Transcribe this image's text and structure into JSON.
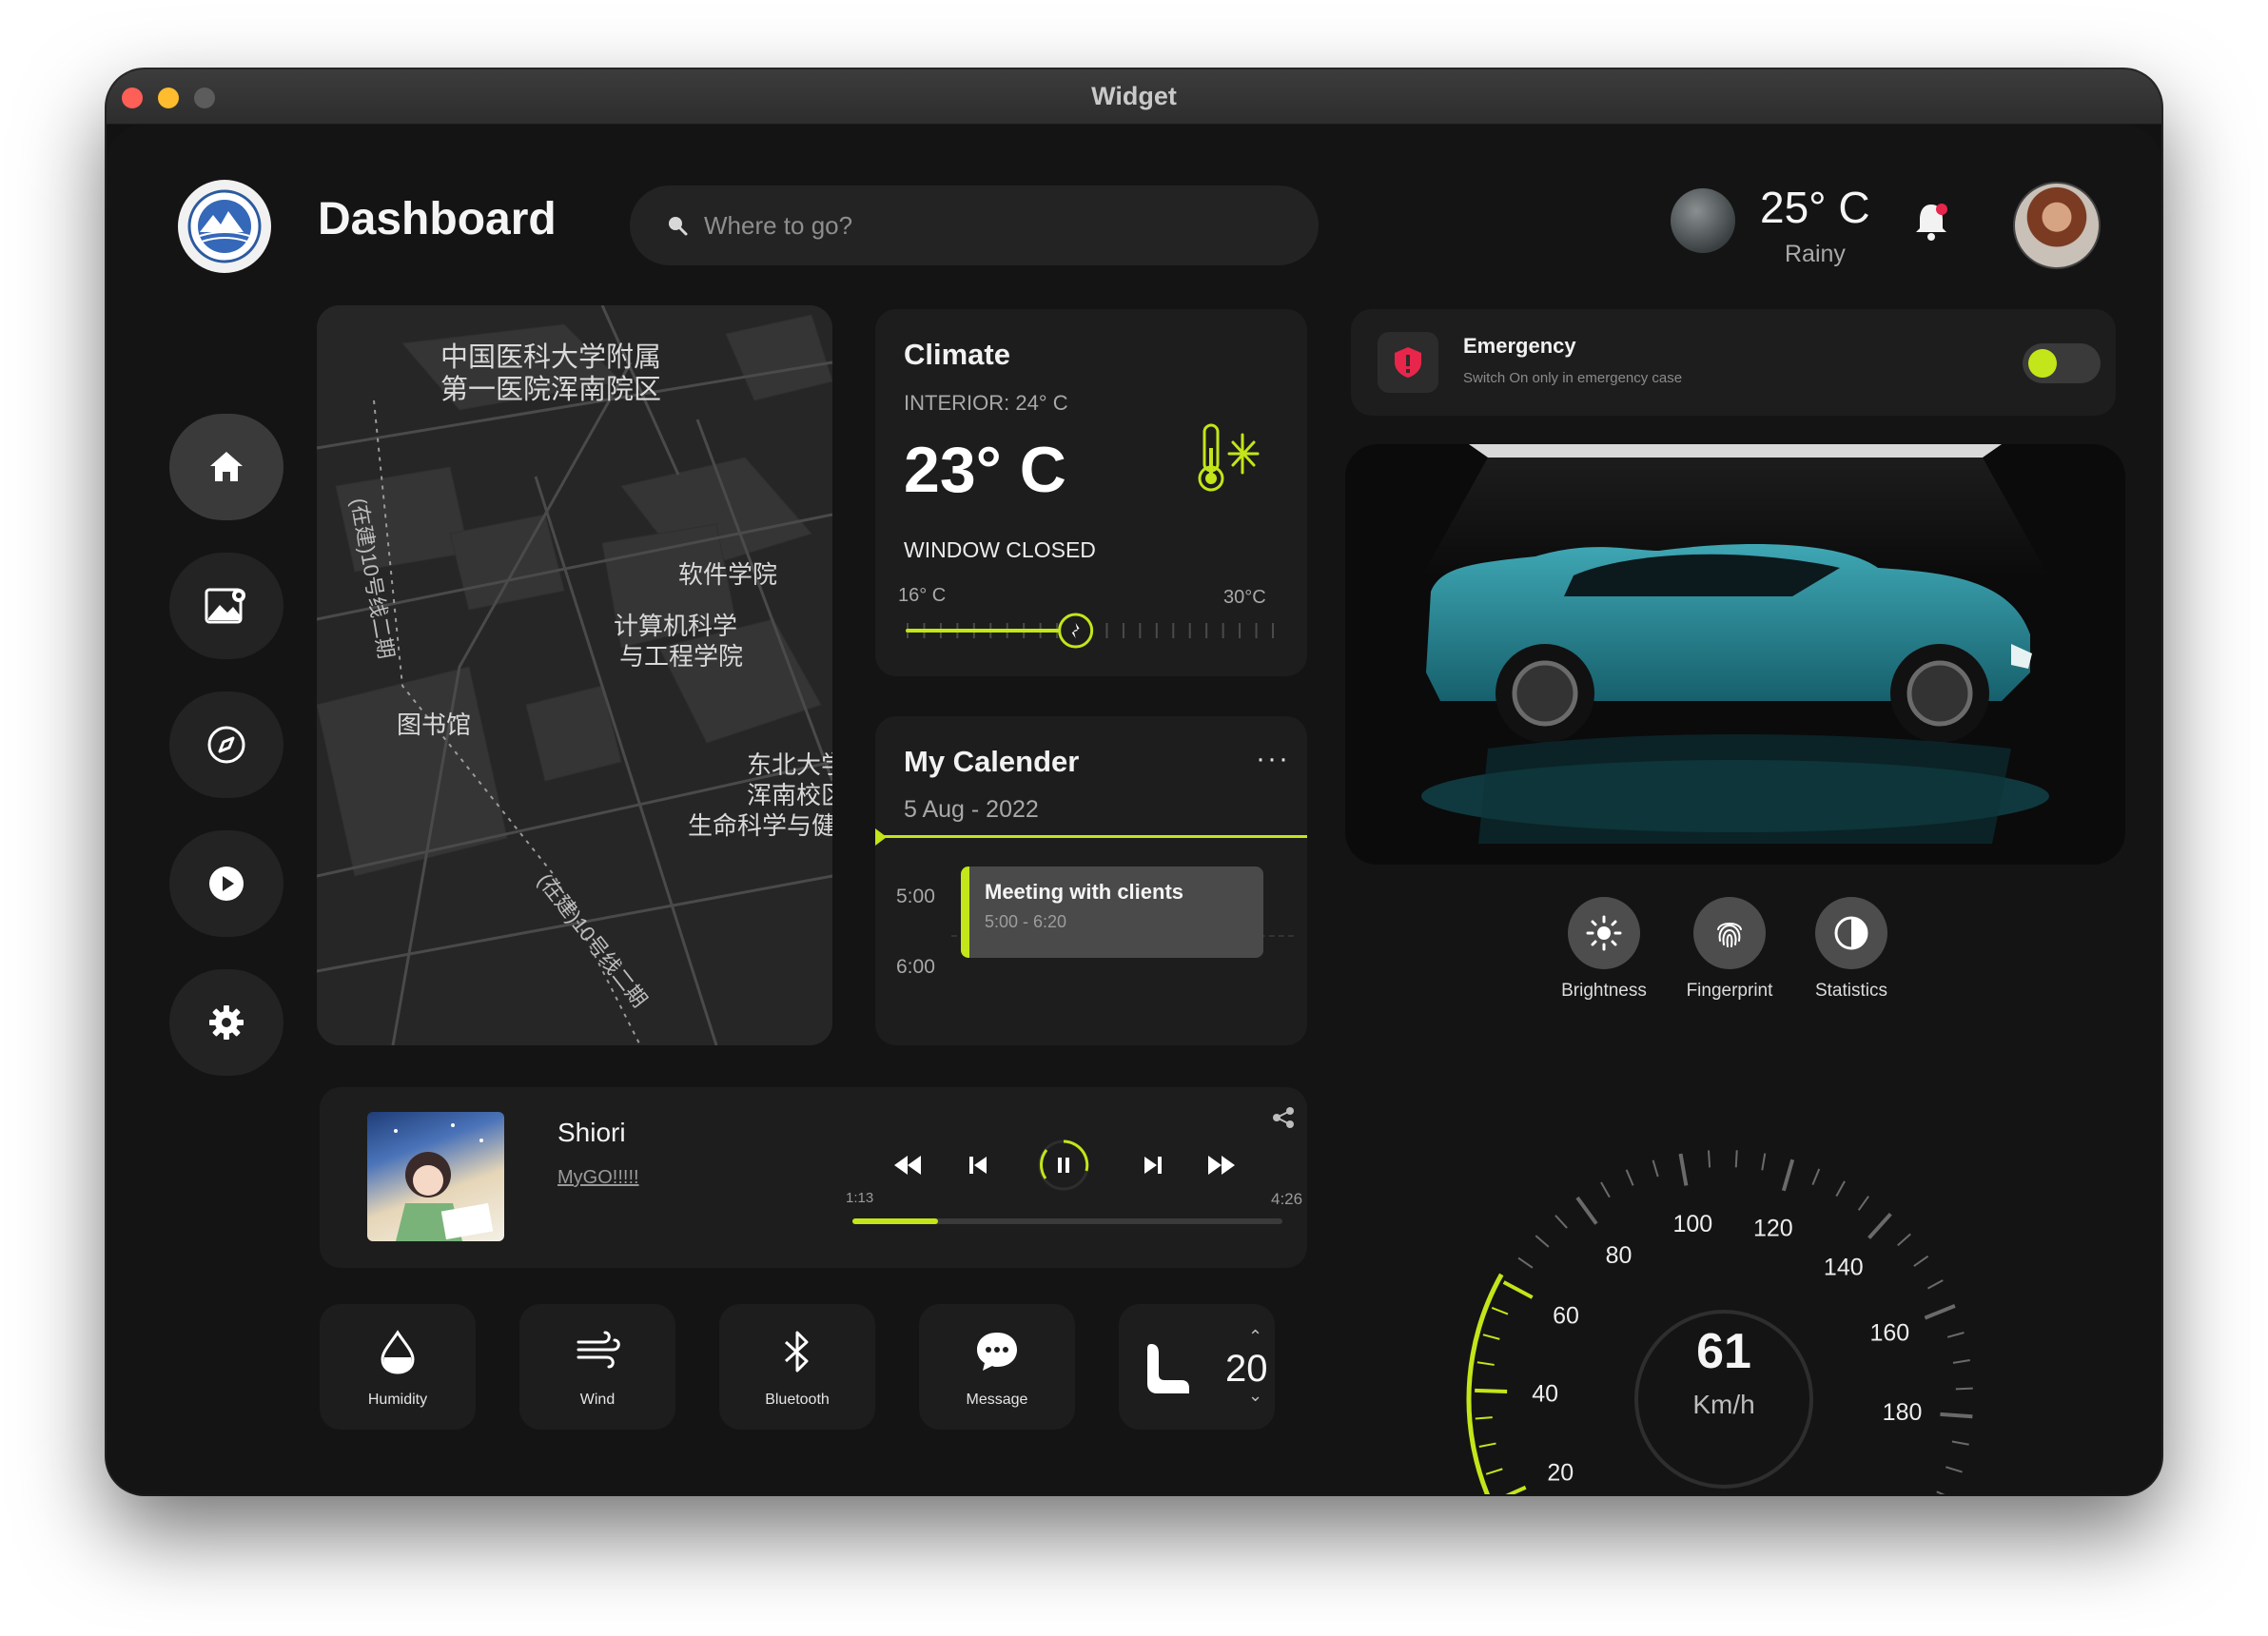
{
  "window": {
    "title": "Widget"
  },
  "header": {
    "title": "Dashboard",
    "search_placeholder": "Where to go?",
    "weather": {
      "temperature": "25° C",
      "condition": "Rainy"
    }
  },
  "sidebar": {
    "items": [
      {
        "name": "home",
        "icon": "home-icon",
        "active": true
      },
      {
        "name": "map",
        "icon": "map-icon",
        "active": false
      },
      {
        "name": "compass",
        "icon": "compass-icon",
        "active": false
      },
      {
        "name": "media",
        "icon": "play-icon",
        "active": false
      },
      {
        "name": "settings",
        "icon": "gear-icon",
        "active": false
      }
    ]
  },
  "map": {
    "labels": [
      "中国医科大学附属",
      "第一医院浑南院区",
      "软件学院",
      "计算机科学",
      "与工程学院",
      "图书馆",
      "东北大学",
      "浑南校区",
      "生命科学与健",
      "(在建)10号线二期",
      "(在建)10号线二期"
    ]
  },
  "climate": {
    "title": "Climate",
    "interior": "INTERIOR: 24° C",
    "temperature": "23° C",
    "window_status": "WINDOW CLOSED",
    "min_label": "16° C",
    "max_label": "30°C",
    "slider_fraction": 0.46
  },
  "calendar": {
    "title": "My Calender",
    "date": "5 Aug - 2022",
    "more": "···",
    "times": [
      "5:00",
      "6:00"
    ],
    "event": {
      "title": "Meeting with clients",
      "time": "5:00 - 6:20"
    }
  },
  "emergency": {
    "title": "Emergency",
    "subtitle": "Switch On only in emergency case",
    "enabled": true
  },
  "quick_actions": [
    {
      "label": "Brightness",
      "icon": "sun-icon"
    },
    {
      "label": "Fingerprint",
      "icon": "fingerprint-icon"
    },
    {
      "label": "Statistics",
      "icon": "contrast-icon"
    }
  ],
  "music": {
    "song": "Shiori",
    "artist": "MyGO!!!!!",
    "current_time": "1:13",
    "duration": "4:26",
    "progress_fraction": 0.2
  },
  "tiles": [
    {
      "label": "Humidity",
      "icon": "droplet-icon"
    },
    {
      "label": "Wind",
      "icon": "wind-icon"
    },
    {
      "label": "Bluetooth",
      "icon": "bluetooth-icon"
    },
    {
      "label": "Message",
      "icon": "message-icon"
    }
  ],
  "seat": {
    "value": "20",
    "icon": "seat-icon"
  },
  "speedometer": {
    "value": "61",
    "unit": "Km/h",
    "ticks": [
      "20",
      "40",
      "60",
      "80",
      "100",
      "120",
      "140",
      "160",
      "180"
    ],
    "accent": "#c2e619"
  },
  "colors": {
    "accent": "#c2e619",
    "card": "#1d1d1d",
    "background": "#141414",
    "alert": "#e8254b"
  }
}
